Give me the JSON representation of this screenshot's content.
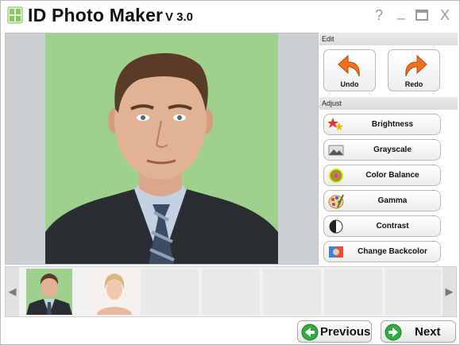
{
  "window": {
    "title": "ID Photo Maker",
    "version": "V 3.0",
    "help_glyph": "?",
    "minimize_glyph": "_",
    "close_glyph": "X"
  },
  "panel": {
    "edit_header": "Edit",
    "adjust_header": "Adjust",
    "undo_label": "Undo",
    "redo_label": "Redo",
    "adjust_items": [
      {
        "label": "Brightness",
        "icon": "brightness-stars-icon"
      },
      {
        "label": "Grayscale",
        "icon": "grayscale-landscape-icon"
      },
      {
        "label": "Color Balance",
        "icon": "color-wheel-icon"
      },
      {
        "label": "Gamma",
        "icon": "palette-icon"
      },
      {
        "label": "Contrast",
        "icon": "contrast-circle-icon"
      },
      {
        "label": "Change Backcolor",
        "icon": "backcolor-swatch-icon"
      }
    ]
  },
  "strip": {
    "left_arrow": "◀",
    "right_arrow": "▶"
  },
  "footer": {
    "previous_label": "Previous",
    "next_label": "Next"
  },
  "colors": {
    "photo_background": "#9fd08d",
    "nav_arrow_green": "#2fae3e",
    "undo_redo_orange": "#f0701e"
  }
}
